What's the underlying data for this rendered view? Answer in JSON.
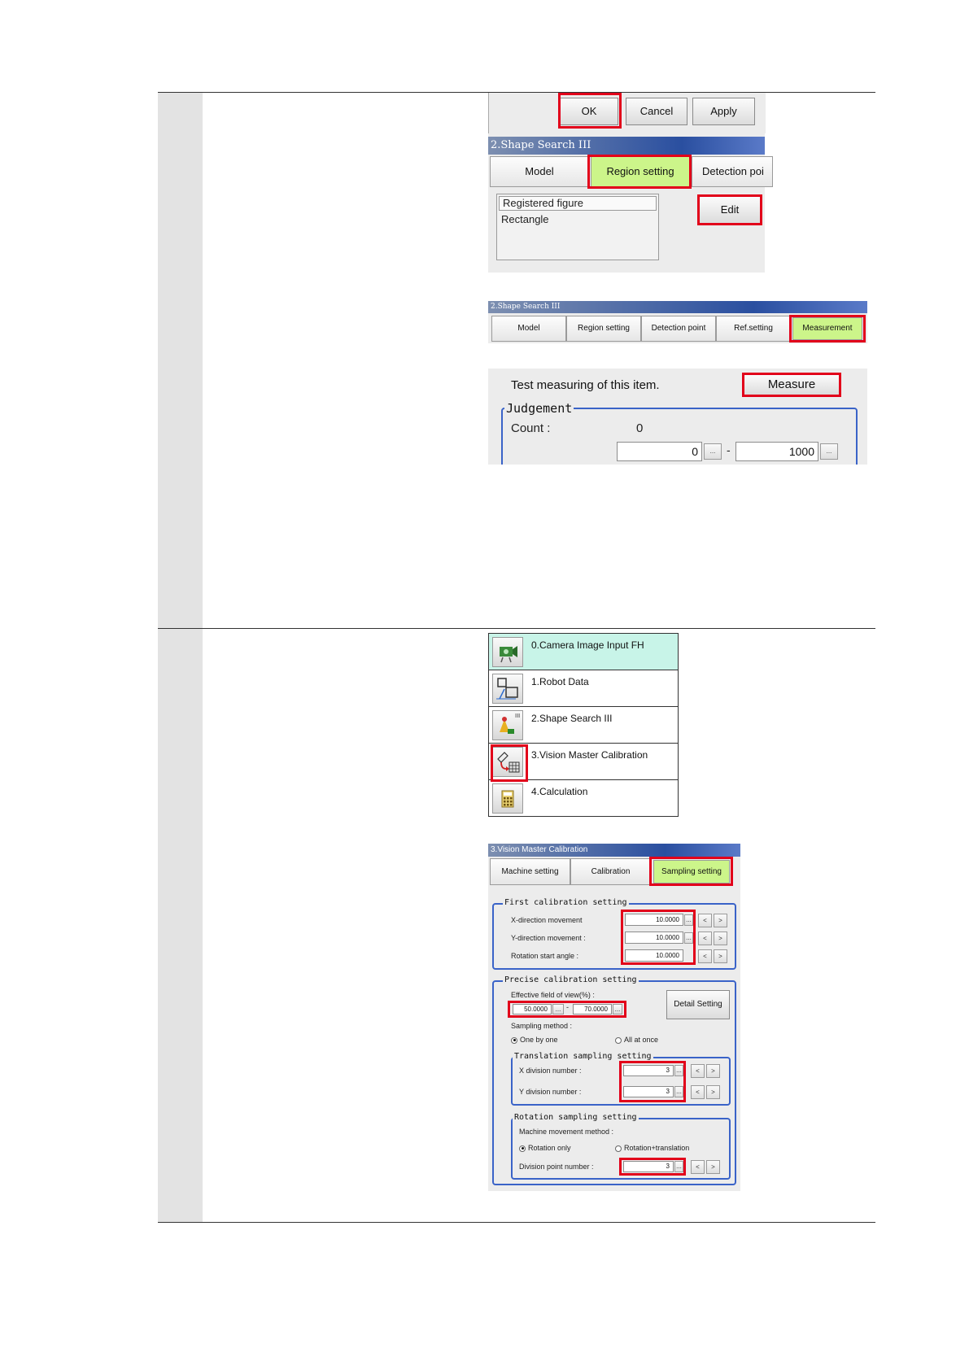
{
  "panel_ok": {
    "ok_label": "OK",
    "cancel_label": "Cancel",
    "apply_label": "Apply",
    "title": "2.Shape Search III",
    "tabs": [
      "Model",
      "Region setting",
      "Detection poi"
    ],
    "list_header": "Registered figure",
    "list_item": "Rectangle",
    "edit_label": "Edit"
  },
  "panel_tabs": {
    "title": "2.Shape Search III",
    "tabs": [
      "Model",
      "Region setting",
      "Detection point",
      "Ref.setting",
      "Measurement"
    ]
  },
  "panel_measure": {
    "test_text": "Test measuring of this item.",
    "measure_label": "Measure",
    "group_label": "Judgement",
    "count_label": "Count :",
    "count_value": "0",
    "min_value": "0",
    "max_value": "1000",
    "separator": "-",
    "dots": "..."
  },
  "flow": {
    "items": [
      {
        "label": "0.Camera Image Input FH"
      },
      {
        "label": "1.Robot Data"
      },
      {
        "label": "2.Shape Search III"
      },
      {
        "label": "3.Vision Master Calibration"
      },
      {
        "label": "4.Calculation"
      }
    ]
  },
  "calib": {
    "title": "3.Vision Master Calibration",
    "tabs": [
      "Machine setting",
      "Calibration",
      "Sampling setting"
    ],
    "first_group": "First calibration setting",
    "x_move_label": "X-direction movement",
    "x_move_value": "10.0000",
    "y_move_label": "Y-direction movement :",
    "y_move_value": "10.0000",
    "rot_label": "Rotation start angle :",
    "rot_value": "10.0000",
    "precise_group": "Precise calibration setting",
    "fov_label": "Effective field of view(%) :",
    "fov_min": "50.0000",
    "fov_max": "70.0000",
    "detail_label": "Detail Setting",
    "sampling_label": "Sampling method :",
    "one_by_one": "One by one",
    "all_at_once": "All at once",
    "trans_group": "Translation sampling setting",
    "x_div_label": "X division number :",
    "x_div_value": "3",
    "y_div_label": "Y division number :",
    "y_div_value": "3",
    "rot_group": "Rotation sampling setting",
    "move_method_label": "Machine movement method :",
    "rotation_only": "Rotation only",
    "rot_trans": "Rotation+translation",
    "div_point_label": "Division point number :",
    "div_point_value": "3",
    "lt": "<",
    "gt": ">",
    "dots": "..."
  },
  "colors": {
    "highlight": "#e2001a",
    "active_tab": "#ccf58a",
    "title_bar": "#2a4fa0",
    "group_border": "#3a63c8"
  }
}
